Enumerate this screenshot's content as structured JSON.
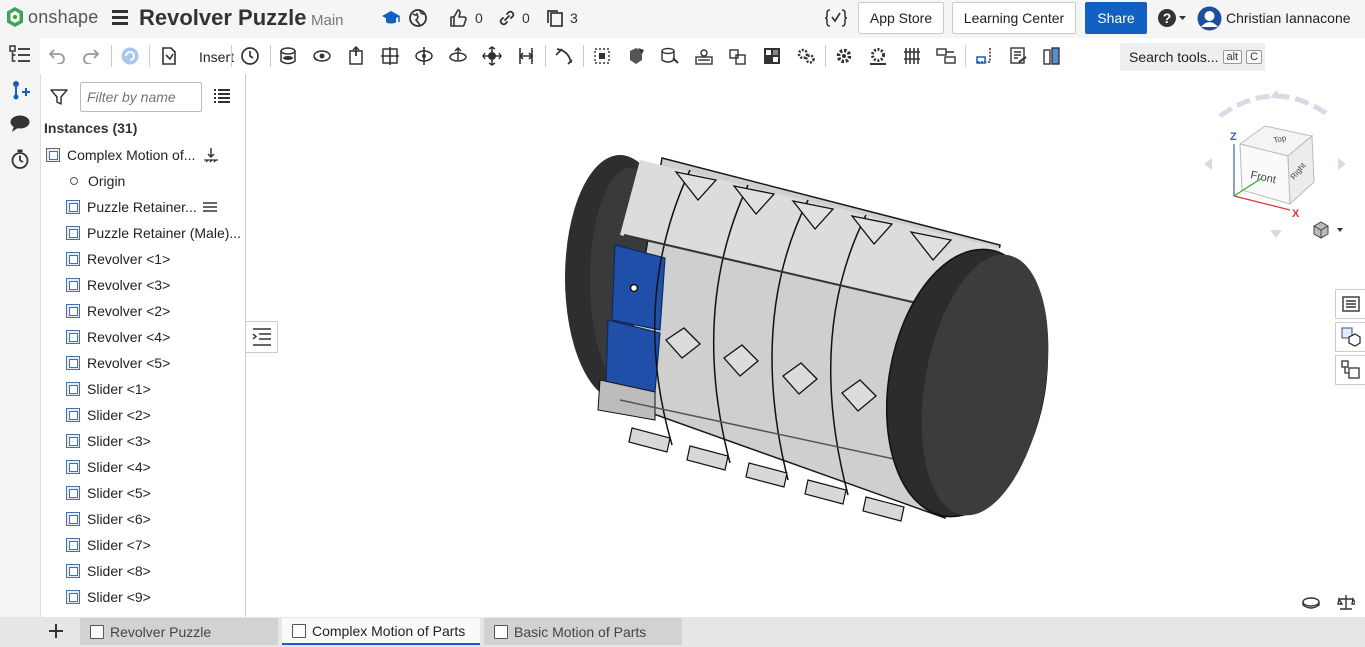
{
  "app": {
    "brand": "onshape",
    "title": "Revolver Puzzle",
    "branch": "Main"
  },
  "header": {
    "likes": "0",
    "links": "0",
    "copies": "3",
    "app_store": "App Store",
    "learning_center": "Learning Center",
    "share": "Share",
    "user": "Christian Iannacone"
  },
  "toolbar": {
    "insert": "Insert",
    "search": "Search tools...",
    "kbd1": "alt",
    "kbd2": "C"
  },
  "panel": {
    "filter_placeholder": "Filter by name",
    "instances_header": "Instances (31)",
    "items": [
      {
        "label": "Complex Motion of...",
        "type": "assembly"
      },
      {
        "label": "Origin",
        "type": "origin"
      },
      {
        "label": "Puzzle Retainer...",
        "type": "part"
      },
      {
        "label": "Puzzle Retainer (Male)...",
        "type": "part"
      },
      {
        "label": "Revolver <1>",
        "type": "part"
      },
      {
        "label": "Revolver <3>",
        "type": "part"
      },
      {
        "label": "Revolver <2>",
        "type": "part"
      },
      {
        "label": "Revolver <4>",
        "type": "part"
      },
      {
        "label": "Revolver <5>",
        "type": "part"
      },
      {
        "label": "Slider <1>",
        "type": "part"
      },
      {
        "label": "Slider <2>",
        "type": "part"
      },
      {
        "label": "Slider <3>",
        "type": "part"
      },
      {
        "label": "Slider <4>",
        "type": "part"
      },
      {
        "label": "Slider <5>",
        "type": "part"
      },
      {
        "label": "Slider <6>",
        "type": "part"
      },
      {
        "label": "Slider <7>",
        "type": "part"
      },
      {
        "label": "Slider <8>",
        "type": "part"
      },
      {
        "label": "Slider <9>",
        "type": "part"
      }
    ]
  },
  "viewcube": {
    "top": "Top",
    "front": "Front",
    "right": "Right",
    "x": "X",
    "z": "Z"
  },
  "tabs": [
    {
      "label": "Revolver Puzzle",
      "active": false
    },
    {
      "label": "Complex Motion of Parts",
      "active": true
    },
    {
      "label": "Basic Motion of Parts",
      "active": false
    }
  ],
  "colors": {
    "accent": "#1160c2",
    "brand_green": "#3aa650",
    "part_blue": "#1f4fa8"
  }
}
